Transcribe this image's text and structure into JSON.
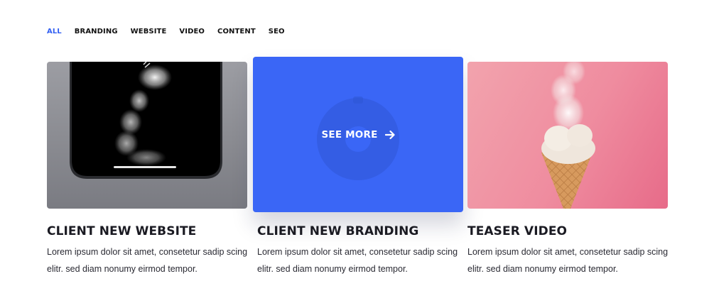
{
  "filters": [
    {
      "label": "ALL",
      "active": true
    },
    {
      "label": "BRANDING",
      "active": false
    },
    {
      "label": "WEBSITE",
      "active": false
    },
    {
      "label": "VIDEO",
      "active": false
    },
    {
      "label": "CONTENT",
      "active": false
    },
    {
      "label": "SEO",
      "active": false
    }
  ],
  "cards": [
    {
      "title": "CLIENT NEW WEBSITE",
      "description": "Lorem ipsum dolor sit amet, consetetur sadip scing elitr. sed diam nonumy eirmod tempor.",
      "image": "phone-smoke-image"
    },
    {
      "title": "CLIENT NEW BRANDING",
      "description": "Lorem ipsum dolor sit amet, consetetur sadip scing elitr. sed diam nonumy eirmod tempor.",
      "image": "donut-image",
      "overlay_label": "SEE MORE",
      "overlay_icon": "arrow-right-icon"
    },
    {
      "title": "TEASER VIDEO",
      "description": "Lorem ipsum dolor sit amet, consetetur sadip scing elitr. sed diam nonumy eirmod tempor.",
      "image": "ice-cream-smoke-image"
    }
  ],
  "colors": {
    "accent": "#3360f2",
    "overlay": "#3a66f6",
    "text": "#1a1a22"
  }
}
